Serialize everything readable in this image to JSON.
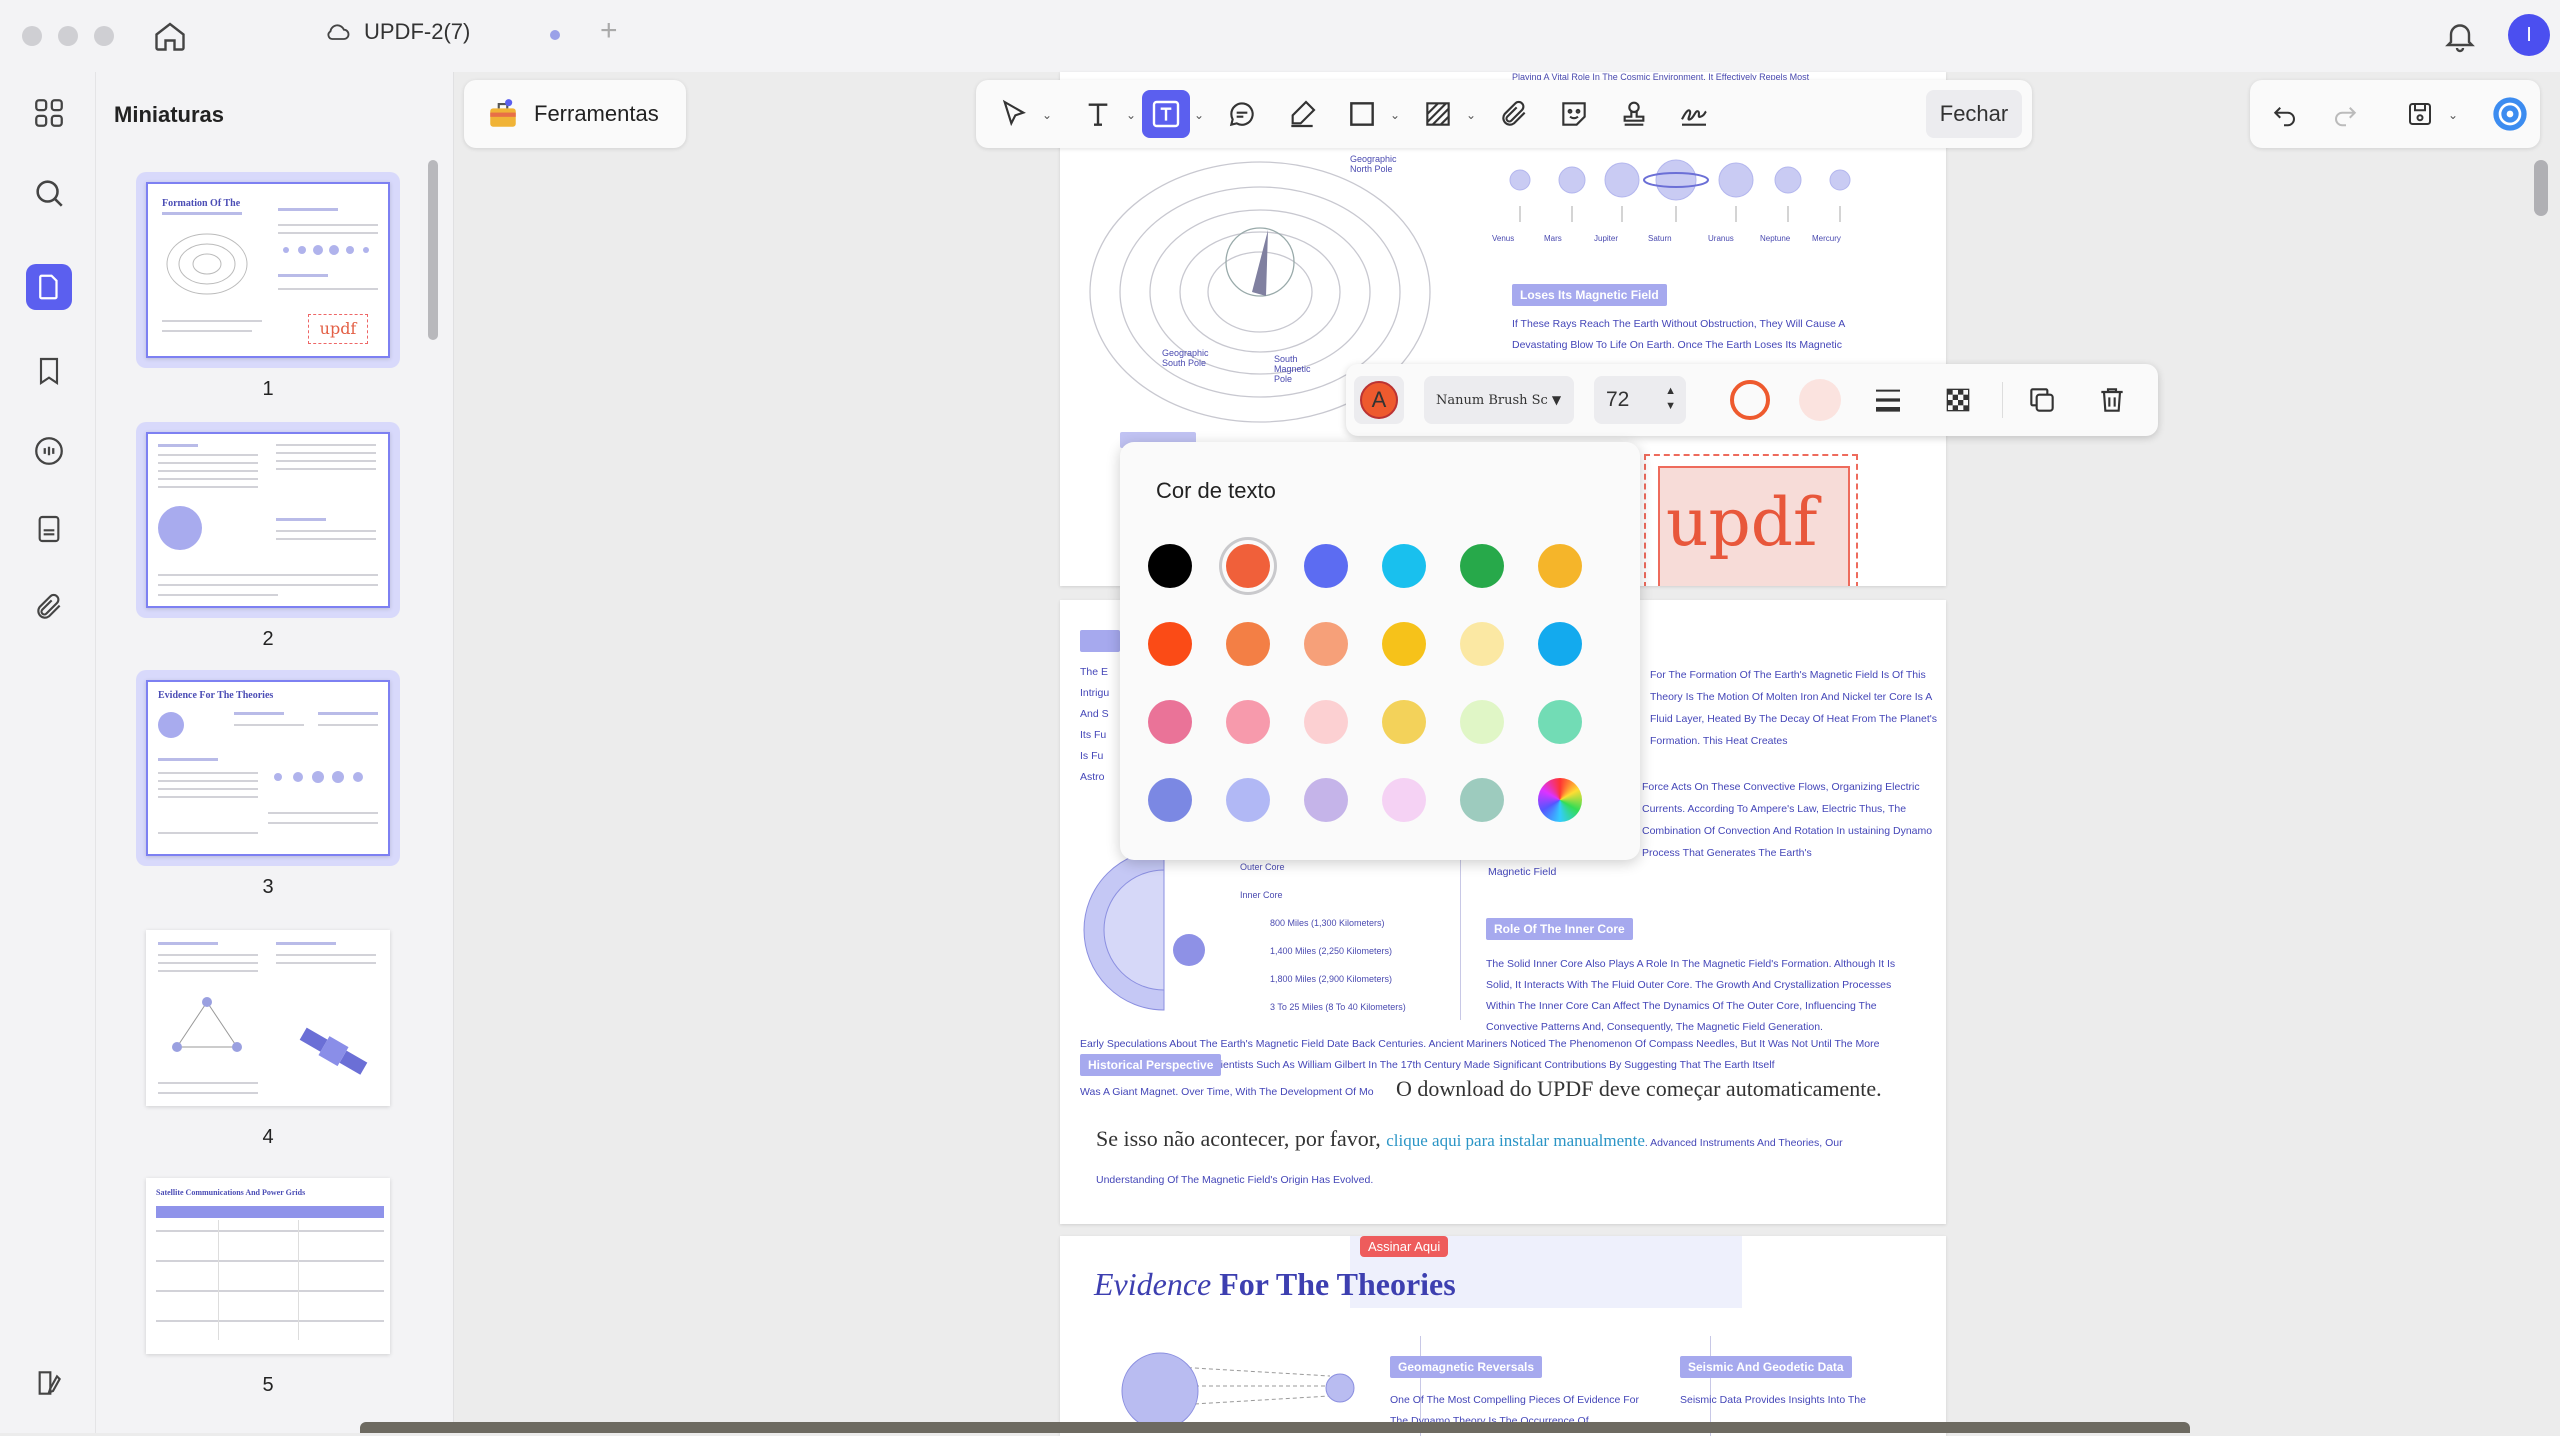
{
  "titlebar": {
    "tab_title": "UPDF-2(7)",
    "avatar_letter": "I",
    "accent": "#5b5fef"
  },
  "left_rail": {
    "icons": [
      "apps-grid-icon",
      "search-icon",
      "pages-icon",
      "bookmark-icon",
      "comment-icon",
      "form-icon",
      "attachment-icon",
      "sidebar-toggle-icon"
    ],
    "active": "pages-icon"
  },
  "thumbnails": {
    "title": "Miniaturas",
    "pages": [
      {
        "num": "1",
        "selected": true,
        "heading": "Formation Of The",
        "stamp": "updf"
      },
      {
        "num": "2",
        "selected": true
      },
      {
        "num": "3",
        "selected": true,
        "heading": "Evidence For The Theories"
      },
      {
        "num": "4",
        "selected": false
      },
      {
        "num": "5",
        "selected": false,
        "heading": "Satellite Communications And Power Grids"
      }
    ]
  },
  "toolbar": {
    "ferramentas_label": "Ferramentas",
    "fechar_label": "Fechar",
    "active_tool": "text-box-icon"
  },
  "format_bar": {
    "text_color": "#ee5a2e",
    "font_name": "Nanum Brush Sc",
    "font_size": "72",
    "border_color": "#ee5a2e",
    "fill_color": "#fbe3df"
  },
  "color_picker": {
    "title": "Cor de texto",
    "selected": "#f0603a",
    "swatches": [
      [
        "#000000",
        "#f0603a",
        "#5c6cf2",
        "#19c0ee",
        "#27a94a",
        "#f5b52a"
      ],
      [
        "#fb4b16",
        "#f37f45",
        "#f6a079",
        "#f6c21a",
        "#fbe8a3",
        "#13aaee"
      ],
      [
        "#ea7398",
        "#f79aac",
        "#fcd0d2",
        "#f3d25a",
        "#e0f6c6",
        "#72dcb5"
      ],
      [
        "#7b88e3",
        "#b1b8f5",
        "#c5b4e9",
        "#f5d2f4",
        "#9dcbbe",
        "rainbow"
      ]
    ]
  },
  "document": {
    "page1": {
      "planets": [
        "Venus",
        "Mars",
        "Jupiter",
        "Saturn",
        "Uranus",
        "Neptune",
        "Mercury"
      ],
      "diagram_labels": [
        "Geographic North Pole",
        "Geographic South Pole",
        "South Magnetic Pole"
      ],
      "section_tag": "Loses Its Magnetic Field",
      "para": "If These Rays Reach The Earth Without Obstruction, They Will Cause A Devastating Blow To Life On Earth. Once The Earth Loses Its Magnetic",
      "top_text": "Playing A Vital Role In The Cosmic Environment, It Effectively Repels Most",
      "stamp_text": "updf"
    },
    "page2": {
      "para_right": "For The Formation Of The Earth's Magnetic Field Is Of This Theory Is The Motion Of Molten Iron And Nickel ter Core Is A Fluid Layer, Heated By The Decay Of Heat From The Planet's Formation. This Heat Creates",
      "para_right2": "Force Acts On These Convective Flows, Organizing Electric Currents. According To Ampere's Law, Electric Thus, The Combination Of Convection And Rotation In ustaining Dynamo Process That Generates The Earth's",
      "magnetic_field": "Magnetic Field",
      "core_labels": [
        "Outer Core",
        "Inner Core",
        "800 Miles (1,300 Kilometers)",
        "1,400 Miles (2,250 Kilometers)",
        "1,800 Miles (2,900 Kilometers)",
        "3 To 25 Miles (8 To 40 Kilometers)"
      ],
      "inner_core_tag": "Role Of The Inner Core",
      "inner_core_para": "The Solid Inner Core Also Plays A Role In The Magnetic Field's Formation. Although It Is Solid, It Interacts With The Fluid Outer Core. The Growth And Crystallization Processes Within The Inner Core Can Affect The Dynamics Of The Outer Core, Influencing The Convective Patterns And, Consequently, The Magnetic Field Generation.",
      "history_para": "Early Speculations About The Earth's Magnetic Field Date Back Centuries. Ancient Mariners Noticed The Phenomenon Of Compass Needles, But It Was Not Until The More Systematic Studies Began. Scientists Such As William Gilbert In The 17th Century Made Significant Contributions By Suggesting That The Earth Itself",
      "history_tail": "Was A Giant Magnet. Over Time, With The Development Of Mo",
      "tag_historical": "Historical Perspective",
      "overlay_line1": "O download do UPDF deve começar automaticamente.",
      "overlay_line2a": "Se isso não acontecer, por favor,",
      "overlay_link": "clique aqui para instalar manualmente",
      "overlay_line2b": ". Advanced Instruments And Theories, Our",
      "last_line": "Understanding Of The Magnetic Field's Origin Has Evolved."
    },
    "page3": {
      "stamp": "Assinar Aqui",
      "title_italic": "Evidence",
      "title_bold": "For The Theories",
      "tag_geo": "Geomagnetic Reversals",
      "tag_seismic": "Seismic And Geodetic Data",
      "para_geo": "One Of The Most Compelling Pieces Of Evidence For The Dynamo Theory Is The Occurrence Of",
      "para_seismic": "Seismic Data Provides Insights Into The"
    }
  }
}
